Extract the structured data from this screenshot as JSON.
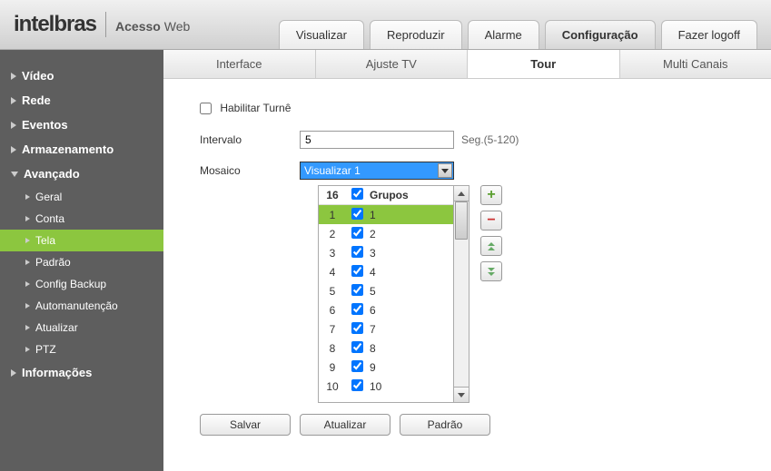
{
  "header": {
    "brand": "intelbras",
    "subtitle_bold": "Acesso",
    "subtitle_light": "Web",
    "tabs": [
      {
        "label": "Visualizar",
        "active": false
      },
      {
        "label": "Reproduzir",
        "active": false
      },
      {
        "label": "Alarme",
        "active": false
      },
      {
        "label": "Configuração",
        "active": true
      },
      {
        "label": "Fazer logoff",
        "active": false
      }
    ]
  },
  "sidebar": {
    "items": [
      {
        "label": "Vídeo",
        "expanded": false
      },
      {
        "label": "Rede",
        "expanded": false
      },
      {
        "label": "Eventos",
        "expanded": false
      },
      {
        "label": "Armazenamento",
        "expanded": false
      },
      {
        "label": "Avançado",
        "expanded": true,
        "children": [
          {
            "label": "Geral",
            "active": false
          },
          {
            "label": "Conta",
            "active": false
          },
          {
            "label": "Tela",
            "active": true
          },
          {
            "label": "Padrão",
            "active": false
          },
          {
            "label": "Config Backup",
            "active": false
          },
          {
            "label": "Automanutenção",
            "active": false
          },
          {
            "label": "Atualizar",
            "active": false
          },
          {
            "label": "PTZ",
            "active": false
          }
        ]
      },
      {
        "label": "Informações",
        "expanded": false
      }
    ]
  },
  "subtabs": [
    {
      "label": "Interface",
      "active": false
    },
    {
      "label": "Ajuste TV",
      "active": false
    },
    {
      "label": "Tour",
      "active": true
    },
    {
      "label": "Multi Canais",
      "active": false
    }
  ],
  "form": {
    "enable_label": "Habilitar Turnê",
    "enable_checked": false,
    "intervalo_label": "Intervalo",
    "intervalo_value": "5",
    "intervalo_hint": "Seg.(5-120)",
    "mosaico_label": "Mosaico",
    "mosaico_value": "Visualizar 1"
  },
  "grid": {
    "header_count": "16",
    "header_label": "Grupos",
    "rows": [
      {
        "n": "1",
        "checked": true,
        "g": "1",
        "selected": true
      },
      {
        "n": "2",
        "checked": true,
        "g": "2",
        "selected": false
      },
      {
        "n": "3",
        "checked": true,
        "g": "3",
        "selected": false
      },
      {
        "n": "4",
        "checked": true,
        "g": "4",
        "selected": false
      },
      {
        "n": "5",
        "checked": true,
        "g": "5",
        "selected": false
      },
      {
        "n": "6",
        "checked": true,
        "g": "6",
        "selected": false
      },
      {
        "n": "7",
        "checked": true,
        "g": "7",
        "selected": false
      },
      {
        "n": "8",
        "checked": true,
        "g": "8",
        "selected": false
      },
      {
        "n": "9",
        "checked": true,
        "g": "9",
        "selected": false
      },
      {
        "n": "10",
        "checked": true,
        "g": "10",
        "selected": false
      }
    ]
  },
  "buttons": {
    "save": "Salvar",
    "refresh": "Atualizar",
    "default": "Padrão"
  }
}
